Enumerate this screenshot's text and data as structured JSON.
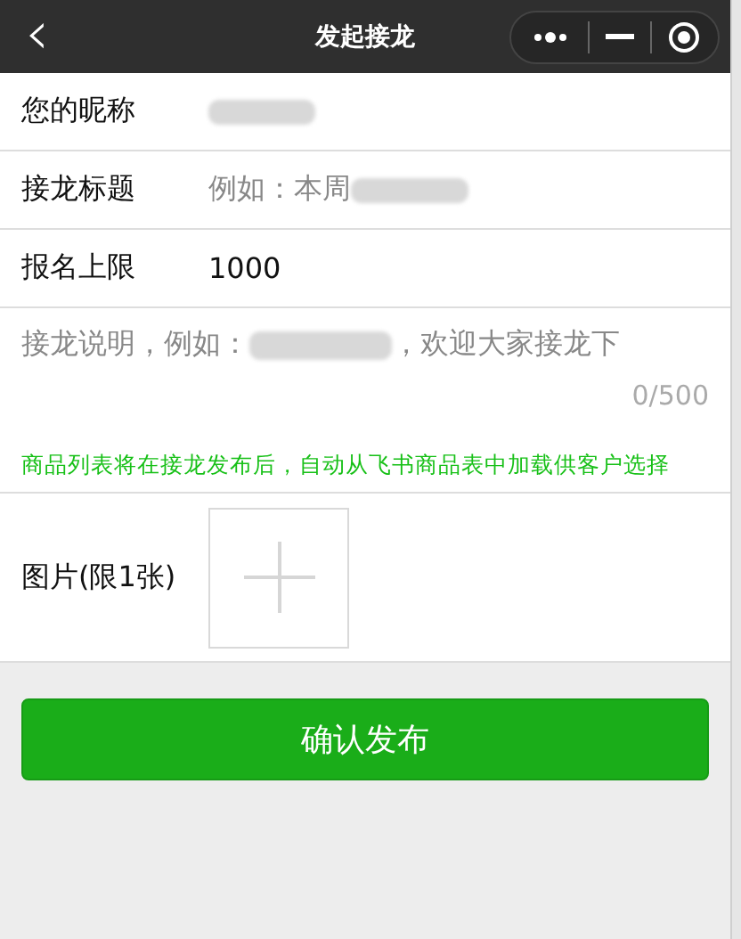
{
  "nav": {
    "back": "‹",
    "title": "发起接龙"
  },
  "fields": [
    {
      "kind": "redacted",
      "label": "您的昵称"
    },
    {
      "kind": "placeholder",
      "label": "接龙标题",
      "placeholder": "例如：本周"
    },
    {
      "kind": "value",
      "label": "报名上限",
      "value": "1000"
    }
  ],
  "description": {
    "placeholder_start": "接龙说明，例如：",
    "placeholder_end": "，欢迎大家接龙下",
    "counter": "0/500"
  },
  "note": "商品列表将在接龙发布后，自动从飞书商品表中加载供客户选择",
  "image": {
    "label": "图片(限1张)"
  },
  "submit": "确认发布"
}
